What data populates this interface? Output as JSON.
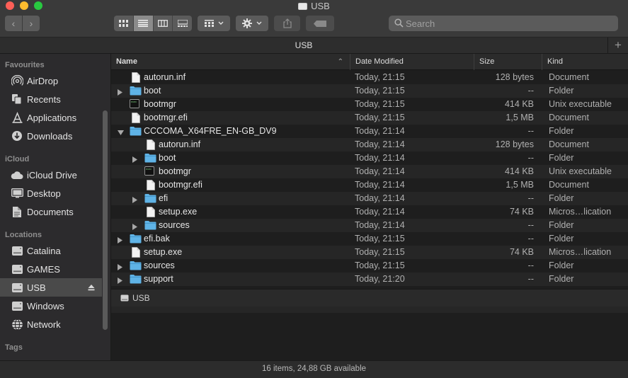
{
  "window": {
    "title": "USB"
  },
  "toolbar": {
    "search_placeholder": "Search"
  },
  "tab": {
    "label": "USB"
  },
  "sidebar": {
    "sections": [
      {
        "header": "Favourites",
        "items": [
          {
            "label": "AirDrop",
            "icon": "airdrop-icon"
          },
          {
            "label": "Recents",
            "icon": "recents-icon"
          },
          {
            "label": "Applications",
            "icon": "applications-icon"
          },
          {
            "label": "Downloads",
            "icon": "downloads-icon"
          }
        ]
      },
      {
        "header": "iCloud",
        "items": [
          {
            "label": "iCloud Drive",
            "icon": "cloud-icon"
          },
          {
            "label": "Desktop",
            "icon": "desktop-icon"
          },
          {
            "label": "Documents",
            "icon": "documents-icon"
          }
        ]
      },
      {
        "header": "Locations",
        "items": [
          {
            "label": "Catalina",
            "icon": "drive-icon"
          },
          {
            "label": "GAMES",
            "icon": "drive-icon"
          },
          {
            "label": "USB",
            "icon": "drive-icon",
            "selected": true
          },
          {
            "label": "Windows",
            "icon": "drive-icon"
          },
          {
            "label": "Network",
            "icon": "network-icon"
          }
        ]
      },
      {
        "header": "Tags",
        "items": []
      }
    ]
  },
  "columns": {
    "name": "Name",
    "date": "Date Modified",
    "size": "Size",
    "kind": "Kind"
  },
  "files": [
    {
      "name": "autorun.inf",
      "date": "Today, 21:15",
      "size": "128 bytes",
      "kind": "Document",
      "type": "doc",
      "level": 0
    },
    {
      "name": "boot",
      "date": "Today, 21:15",
      "size": "--",
      "kind": "Folder",
      "type": "folder",
      "level": 0,
      "expanded": false
    },
    {
      "name": "bootmgr",
      "date": "Today, 21:15",
      "size": "414 KB",
      "kind": "Unix executable",
      "type": "exec",
      "level": 0
    },
    {
      "name": "bootmgr.efi",
      "date": "Today, 21:15",
      "size": "1,5 MB",
      "kind": "Document",
      "type": "doc",
      "level": 0
    },
    {
      "name": "CCCOMA_X64FRE_EN-GB_DV9",
      "date": "Today, 21:14",
      "size": "--",
      "kind": "Folder",
      "type": "folder",
      "level": 0,
      "expanded": true
    },
    {
      "name": "autorun.inf",
      "date": "Today, 21:14",
      "size": "128 bytes",
      "kind": "Document",
      "type": "doc",
      "level": 1
    },
    {
      "name": "boot",
      "date": "Today, 21:14",
      "size": "--",
      "kind": "Folder",
      "type": "folder",
      "level": 1,
      "expanded": false
    },
    {
      "name": "bootmgr",
      "date": "Today, 21:14",
      "size": "414 KB",
      "kind": "Unix executable",
      "type": "exec",
      "level": 1
    },
    {
      "name": "bootmgr.efi",
      "date": "Today, 21:14",
      "size": "1,5 MB",
      "kind": "Document",
      "type": "doc",
      "level": 1
    },
    {
      "name": "efi",
      "date": "Today, 21:14",
      "size": "--",
      "kind": "Folder",
      "type": "folder",
      "level": 1,
      "expanded": false
    },
    {
      "name": "setup.exe",
      "date": "Today, 21:14",
      "size": "74 KB",
      "kind": "Micros…lication",
      "type": "doc",
      "level": 1
    },
    {
      "name": "sources",
      "date": "Today, 21:14",
      "size": "--",
      "kind": "Folder",
      "type": "folder",
      "level": 1,
      "expanded": false
    },
    {
      "name": "efi.bak",
      "date": "Today, 21:15",
      "size": "--",
      "kind": "Folder",
      "type": "folder",
      "level": 0,
      "expanded": false
    },
    {
      "name": "setup.exe",
      "date": "Today, 21:15",
      "size": "74 KB",
      "kind": "Micros…lication",
      "type": "doc",
      "level": 0
    },
    {
      "name": "sources",
      "date": "Today, 21:15",
      "size": "--",
      "kind": "Folder",
      "type": "folder",
      "level": 0,
      "expanded": false
    },
    {
      "name": "support",
      "date": "Today, 21:20",
      "size": "--",
      "kind": "Folder",
      "type": "folder",
      "level": 0,
      "expanded": false
    }
  ],
  "pathbar": {
    "label": "USB"
  },
  "status": {
    "text": "16 items, 24,88 GB available"
  },
  "colors": {
    "folder": "#5fb3e6",
    "selection": "#4a4a4a"
  }
}
